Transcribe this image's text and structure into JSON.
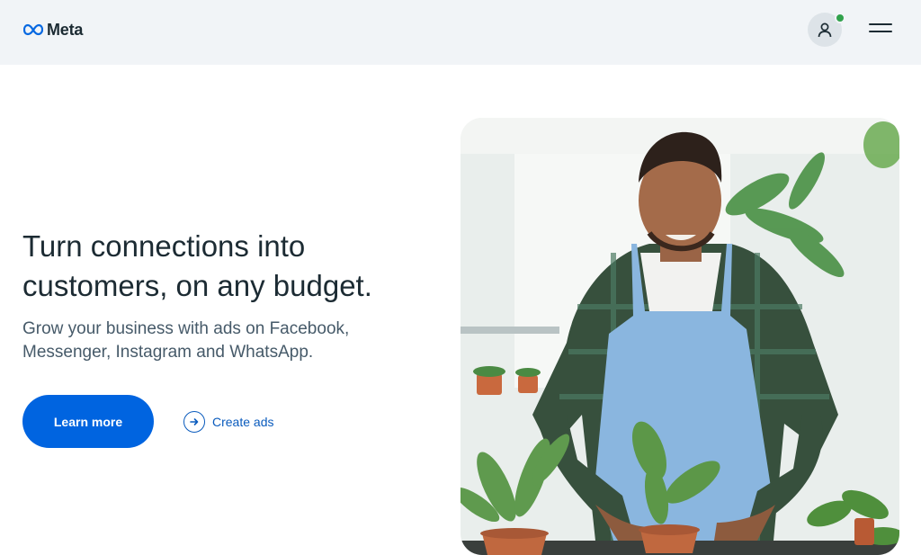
{
  "header": {
    "brand_name": "Meta",
    "icons": {
      "logo": "meta-infinity-logo",
      "account": "user-icon",
      "menu": "hamburger-menu-icon"
    }
  },
  "hero": {
    "headline": "Turn connections into customers, on any budget.",
    "subtext": "Grow your business with ads on Facebook, Messenger, Instagram and WhatsApp.",
    "primary_button_label": "Learn more",
    "secondary_link_label": "Create ads",
    "image_subject": "man-in-apron-potting-plants"
  },
  "colors": {
    "primary": "#0064e0",
    "link": "#0a5bbd",
    "status_online": "#31a24c",
    "header_bg": "#f1f4f7",
    "text_dark": "#1c2b33"
  }
}
